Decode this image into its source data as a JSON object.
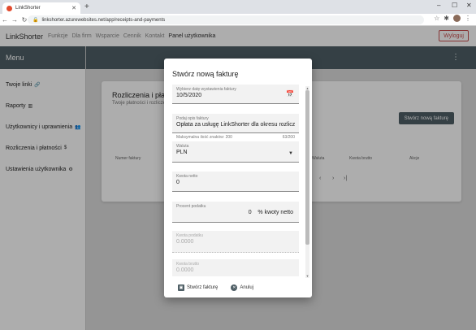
{
  "browser": {
    "tab_title": "LinkShorter",
    "url": "linkshorter.azurewebsites.net/app/receipts-and-payments"
  },
  "header": {
    "brand": "LinkShorter",
    "nav": [
      "Funkcje",
      "Dla firm",
      "Wsparcie",
      "Cennik",
      "Kontakt",
      "Panel użytkownika"
    ],
    "logout": "Wyloguj"
  },
  "sidebar": {
    "title": "Menu",
    "items": [
      {
        "label": "Twoje linki",
        "icon": "link-icon"
      },
      {
        "label": "Raporty",
        "icon": "chart-icon"
      },
      {
        "label": "Użytkownicy i uprawnienia",
        "icon": "users-icon"
      },
      {
        "label": "Rozliczenia i płatności",
        "icon": "dollar-icon"
      },
      {
        "label": "Ustawienia użytkownika",
        "icon": "gears-icon"
      }
    ]
  },
  "card": {
    "title": "Rozliczenia i płat",
    "subtitle": "Twoje płatności i rozliczeni",
    "new_button": "Stwórz nową fakturę",
    "columns": [
      "Numer faktury",
      "Waluta",
      "Kwota brutto",
      "Akcje"
    ]
  },
  "dialog": {
    "title": "Stwórz nową fakturę",
    "date": {
      "label": "Wybierz datę wystawienia faktury",
      "value": "10/5/2020"
    },
    "description": {
      "label": "Podaj opis faktury",
      "value": "Opłata za usługę LinkShorter dla okresu rozliczeni",
      "hint": "Maksymalna ilość znaków: 200",
      "counter": "63/200"
    },
    "currency": {
      "label": "Waluta",
      "value": "PLN"
    },
    "net": {
      "label": "Kwota netto",
      "value": "0"
    },
    "tax_percent": {
      "label": "Procent podatku",
      "value": "0",
      "suffix": "% kwoty netto"
    },
    "tax_amount": {
      "label": "Kwota podatku",
      "value": "0.0000"
    },
    "gross": {
      "label": "Kwota brutto",
      "value": "0.0000"
    },
    "create_button": "Stwórz fakturę",
    "cancel_button": "Anuluj"
  }
}
